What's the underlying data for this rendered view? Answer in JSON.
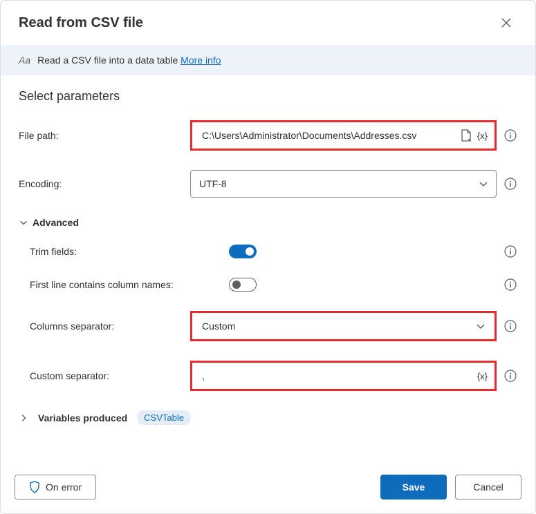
{
  "title": "Read from CSV file",
  "info_strip": {
    "description": "Read a CSV file into a data table",
    "link": "More info"
  },
  "section_title": "Select parameters",
  "fields": {
    "file_path": {
      "label": "File path:",
      "value": "C:\\Users\\Administrator\\Documents\\Addresses.csv"
    },
    "encoding": {
      "label": "Encoding:",
      "value": "UTF-8"
    }
  },
  "advanced": {
    "title": "Advanced",
    "trim_fields": {
      "label": "Trim fields:",
      "on": true
    },
    "first_line_names": {
      "label": "First line contains column names:",
      "on": false
    },
    "columns_separator": {
      "label": "Columns separator:",
      "value": "Custom"
    },
    "custom_separator": {
      "label": "Custom separator:",
      "value": ","
    }
  },
  "variables": {
    "label": "Variables produced",
    "badge": "CSVTable"
  },
  "footer": {
    "on_error": "On error",
    "save": "Save",
    "cancel": "Cancel"
  }
}
